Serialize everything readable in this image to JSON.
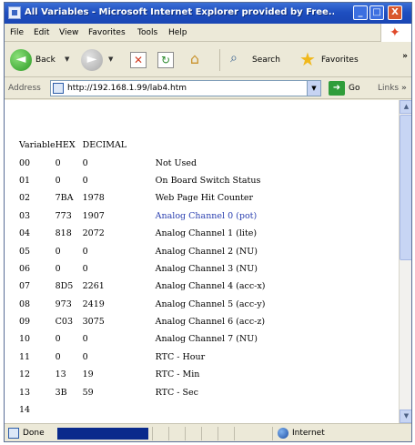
{
  "window": {
    "title": "All Variables - Microsoft Internet Explorer provided by Free...",
    "minimize_glyph": "_",
    "maximize_glyph": "□",
    "close_glyph": "X"
  },
  "menu": [
    "File",
    "Edit",
    "View",
    "Favorites",
    "Tools",
    "Help"
  ],
  "toolbar": {
    "back_label": "Back",
    "search_label": "Search",
    "favorites_label": "Favorites",
    "overflow": "»"
  },
  "address_bar": {
    "label": "Address",
    "url": "http://192.168.1.99/lab4.htm",
    "go_label": "Go",
    "links_label": "Links",
    "links_overflow": "»"
  },
  "table": {
    "headers": [
      "Variable",
      "HEX",
      "DECIMAL"
    ],
    "rows": [
      {
        "var": "00",
        "hex": "0",
        "dec": "0",
        "desc": "Not Used"
      },
      {
        "var": "01",
        "hex": "0",
        "dec": "0",
        "desc": "On Board Switch Status"
      },
      {
        "var": "02",
        "hex": "7BA",
        "dec": "1978",
        "desc": "Web Page Hit Counter"
      },
      {
        "var": "03",
        "hex": "773",
        "dec": "1907",
        "desc": "Analog Channel 0 (pot)"
      },
      {
        "var": "04",
        "hex": "818",
        "dec": "2072",
        "desc": "Analog Channel 1 (lite)"
      },
      {
        "var": "05",
        "hex": "0",
        "dec": "0",
        "desc": "Analog Channel 2 (NU)"
      },
      {
        "var": "06",
        "hex": "0",
        "dec": "0",
        "desc": "Analog Channel 3 (NU)"
      },
      {
        "var": "07",
        "hex": "8D5",
        "dec": "2261",
        "desc": "Analog Channel 4 (acc-x)"
      },
      {
        "var": "08",
        "hex": "973",
        "dec": "2419",
        "desc": "Analog Channel 5 (acc-y)"
      },
      {
        "var": "09",
        "hex": "C03",
        "dec": "3075",
        "desc": "Analog Channel 6 (acc-z)"
      },
      {
        "var": "10",
        "hex": "0",
        "dec": "0",
        "desc": "Analog Channel 7 (NU)"
      },
      {
        "var": "11",
        "hex": "0",
        "dec": "0",
        "desc": "RTC - Hour"
      },
      {
        "var": "12",
        "hex": "13",
        "dec": "19",
        "desc": "RTC - Min"
      },
      {
        "var": "13",
        "hex": "3B",
        "dec": "59",
        "desc": "RTC - Sec"
      },
      {
        "var": "14",
        "hex": "",
        "dec": "",
        "desc": ""
      }
    ]
  },
  "status_bar": {
    "text": "Done",
    "zone": "Internet"
  },
  "colors": {
    "title_bar": "#1f4fc0",
    "link": "#2a3fb0",
    "progress": "#0a2a8c"
  },
  "icons": [
    "app-icon",
    "back-arrow-icon",
    "forward-arrow-icon",
    "stop-icon",
    "refresh-icon",
    "home-icon",
    "search-icon",
    "favorites-star-icon",
    "page-icon",
    "go-arrow-icon",
    "internet-zone-icon",
    "windows-logo-icon"
  ]
}
